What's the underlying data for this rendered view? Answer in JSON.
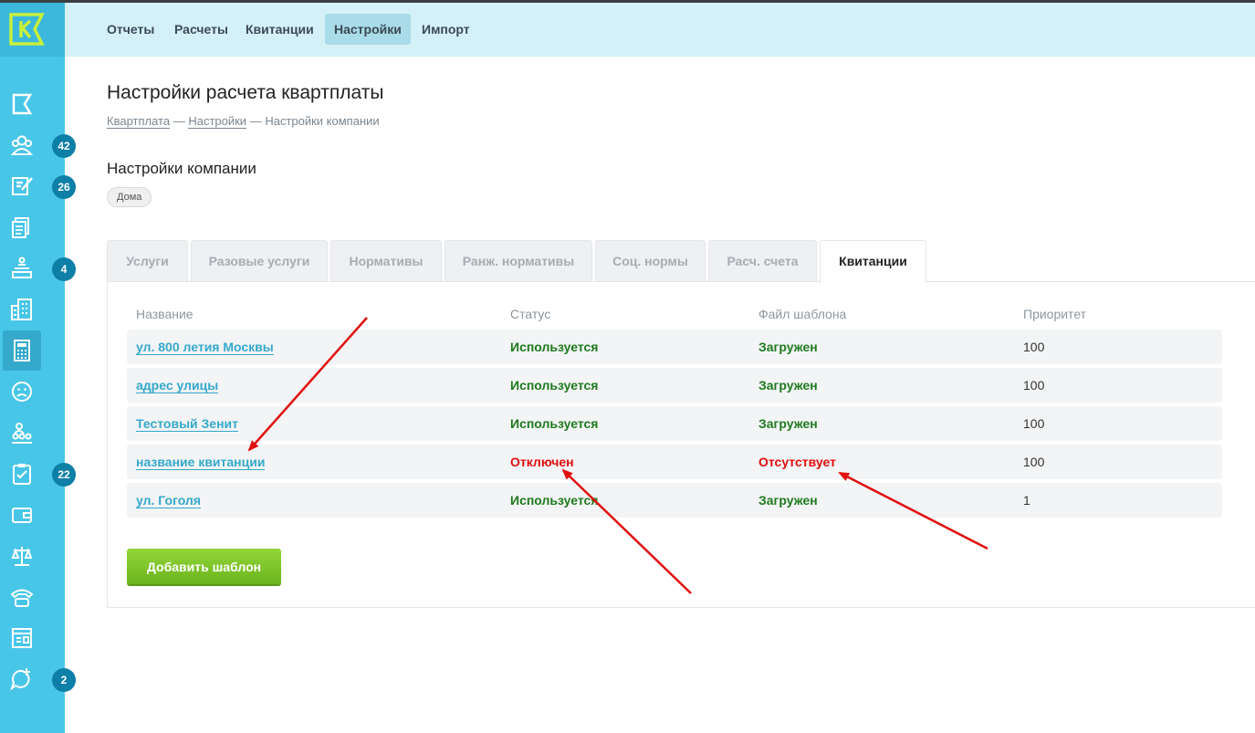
{
  "topnav": [
    {
      "label": "Отчеты",
      "active": false
    },
    {
      "label": "Расчеты",
      "active": false
    },
    {
      "label": "Квитанции",
      "active": false
    },
    {
      "label": "Настройки",
      "active": true
    },
    {
      "label": "Импорт",
      "active": false
    }
  ],
  "sidebar": {
    "logo_letter": "K",
    "items": [
      {
        "icon": "flag-icon",
        "badge": ""
      },
      {
        "icon": "users-icon",
        "badge": "42"
      },
      {
        "icon": "edit-icon",
        "badge": "26"
      },
      {
        "icon": "documents-icon",
        "badge": ""
      },
      {
        "icon": "inbox-tray-icon",
        "badge": "4"
      },
      {
        "icon": "building-icon",
        "badge": ""
      },
      {
        "icon": "calculator-icon",
        "badge": "",
        "active": true
      },
      {
        "icon": "sad-face-icon",
        "badge": ""
      },
      {
        "icon": "team-icon",
        "badge": ""
      },
      {
        "icon": "clipboard-check-icon",
        "badge": "22"
      },
      {
        "icon": "wallet-icon",
        "badge": ""
      },
      {
        "icon": "scales-icon",
        "badge": ""
      },
      {
        "icon": "phone-icon",
        "badge": ""
      },
      {
        "icon": "id-card-icon",
        "badge": ""
      },
      {
        "icon": "chat-plus-icon",
        "badge": "2"
      }
    ]
  },
  "page": {
    "title": "Настройки расчета квартплаты",
    "breadcrumb": [
      "Квартплата",
      "Настройки",
      "Настройки компании"
    ],
    "breadcrumb_sep": "—",
    "section_title": "Настройки компании",
    "pill": "Дома"
  },
  "tabs": [
    {
      "label": "Услуги",
      "active": false
    },
    {
      "label": "Разовые услуги",
      "active": false
    },
    {
      "label": "Нормативы",
      "active": false
    },
    {
      "label": "Ранж. нормативы",
      "active": false
    },
    {
      "label": "Соц. нормы",
      "active": false
    },
    {
      "label": "Расч. счета",
      "active": false
    },
    {
      "label": "Квитанции",
      "active": true
    }
  ],
  "table": {
    "headers": [
      "Название",
      "Статус",
      "Файл шаблона",
      "Приоритет"
    ],
    "rows": [
      {
        "name": "ул. 800 летия Москвы",
        "status": "Используется",
        "file": "Загружен",
        "priority": "100",
        "ok": true
      },
      {
        "name": "адрес улицы",
        "status": "Используется",
        "file": "Загружен",
        "priority": "100",
        "ok": true
      },
      {
        "name": "Тестовый Зенит",
        "status": "Используется",
        "file": "Загружен",
        "priority": "100",
        "ok": true
      },
      {
        "name": "название квитанции",
        "status": "Отключен",
        "file": "Отсутствует",
        "priority": "100",
        "ok": false
      },
      {
        "name": "ул. Гоголя",
        "status": "Используется",
        "file": "Загружен",
        "priority": "1",
        "ok": true
      }
    ]
  },
  "add_button": "Добавить шаблон",
  "colors": {
    "sidebar": "#48c6e8",
    "topbar": "#d5f1f8",
    "ok": "#1e7a1e",
    "bad": "#e00d0d",
    "link": "#34a9cc",
    "button": "#7cc42a",
    "arrow": "#e01010"
  }
}
